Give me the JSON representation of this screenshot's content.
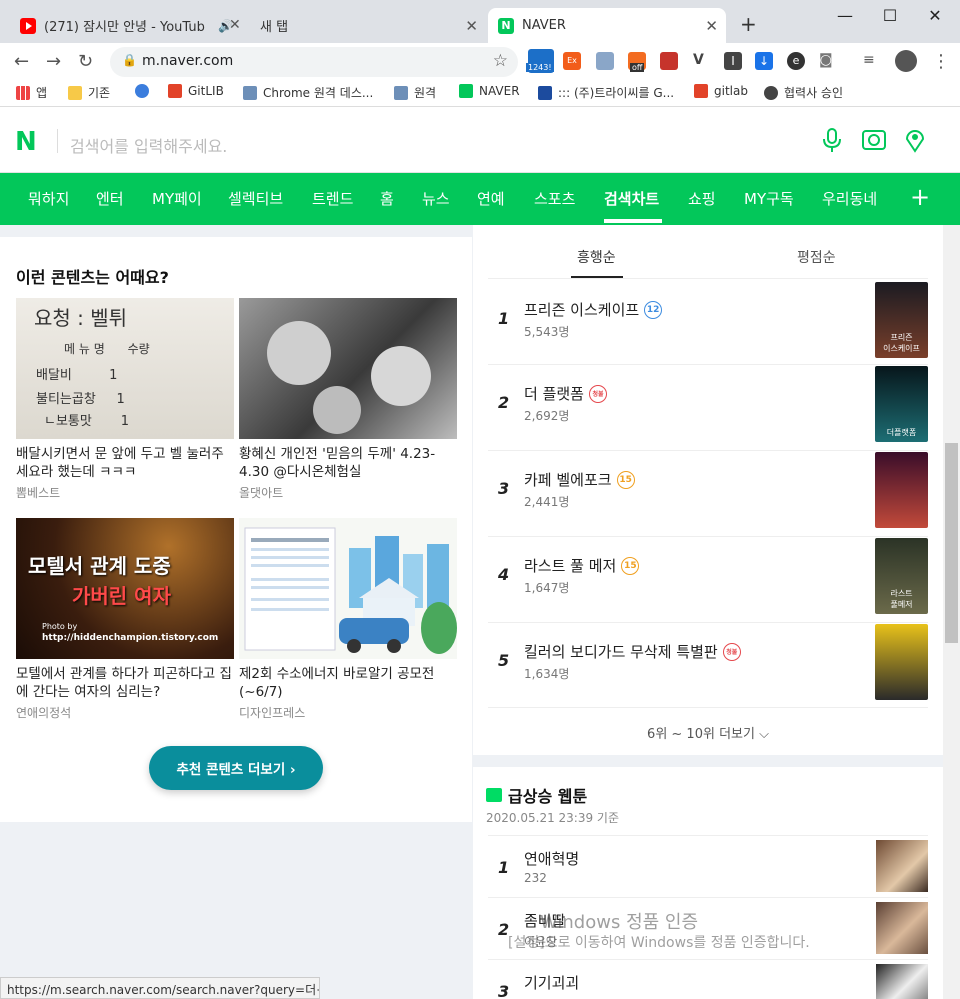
{
  "browser": {
    "tabs": [
      {
        "title": "(271) 잠시만 안녕 - YouTub",
        "audio": "🔊"
      },
      {
        "title": "새 탭"
      },
      {
        "title": "NAVER"
      }
    ],
    "new_tab": "+",
    "window": {
      "minimize": "—",
      "maximize": "☐",
      "close": "✕"
    },
    "url": "m.naver.com",
    "ext_badges": {
      "counter": "1243!",
      "orange": "Ex",
      "off": "off"
    },
    "bookmarks": [
      {
        "label": "앱"
      },
      {
        "label": "기존"
      },
      {
        "label": ""
      },
      {
        "label": "GitLIB"
      },
      {
        "label": "Chrome 원격 데스..."
      },
      {
        "label": "원격"
      },
      {
        "label": "NAVER"
      },
      {
        "label": "::: (주)트라이씨를 G..."
      },
      {
        "label": "gitlab"
      },
      {
        "label": "협력사 승인"
      }
    ]
  },
  "naver": {
    "logo": "N",
    "search_placeholder": "검색어를 입력해주세요.",
    "nav": [
      "뭐하지",
      "엔터",
      "MY페이",
      "셀렉티브",
      "트렌드",
      "홈",
      "뉴스",
      "연예",
      "스포츠",
      "검색차트",
      "쇼핑",
      "MY구독",
      "우리동네"
    ],
    "nav_active": "검색차트",
    "nav_plus": "+"
  },
  "left": {
    "heading": "이런 콘텐츠는 어때요?",
    "cards": [
      {
        "title": "배달시키면서 문 앞에 두고 벨 눌러주세요라 했는데 ㅋㅋㅋ",
        "source": "뽐베스트",
        "thumb_text": [
          "요청 : 벨튀",
          "메 뉴 명      수량",
          "배달비         1",
          "불티는곱창     1",
          "ㄴ보통맛       1"
        ]
      },
      {
        "title": "황혜신 개인전 '믿음의 두께' 4.23-4.30 @다시온체험실",
        "source": "올댓아트"
      },
      {
        "title": "모텔에서 관계를 하다가 피곤하다고 집에 간다는 여자의 심리는?",
        "source": "연애의정석",
        "thumb_text": [
          "모텔서 관계 도중",
          "가버린 여자",
          "Photo by",
          "http://hiddenchampion.tistory.com"
        ]
      },
      {
        "title": "제2회 수소에너지 바로알기 공모전 (~6/7)",
        "source": "디자인프레스"
      }
    ],
    "more_button": "추천 콘텐츠 더보기 ›"
  },
  "movies": {
    "tabs": [
      "흥행순",
      "평점순"
    ],
    "active_tab": "흥행순",
    "items": [
      {
        "rank": "1",
        "title": "프리즌 이스케이프",
        "rating": "12",
        "rating_color": "#3d8ce0",
        "count": "5,543명",
        "poster_colors": [
          "#1b1b22",
          "#7a3f2a"
        ],
        "poster_text": "프리즌\n이스케이프"
      },
      {
        "rank": "2",
        "title": "더 플랫폼",
        "rating": "청불",
        "rating_color": "#e5484d",
        "count": "2,692명",
        "poster_colors": [
          "#07161b",
          "#1d6e74"
        ],
        "poster_text": "더플랫폼"
      },
      {
        "rank": "3",
        "title": "카페 벨에포크",
        "rating": "15",
        "rating_color": "#f0a020",
        "count": "2,441명",
        "poster_colors": [
          "#3a0d2a",
          "#c24a3a"
        ],
        "poster_text": ""
      },
      {
        "rank": "4",
        "title": "라스트 풀 메저",
        "rating": "15",
        "rating_color": "#f0a020",
        "count": "1,647명",
        "poster_colors": [
          "#2b3326",
          "#6b6a4a"
        ],
        "poster_text": "라스트\n풀메저"
      },
      {
        "rank": "5",
        "title": "킬러의 보디가드 무삭제 특별판",
        "rating": "청불",
        "rating_color": "#e5484d",
        "count": "1,634명",
        "poster_colors": [
          "#e8c21a",
          "#2a2a2a"
        ],
        "poster_text": ""
      }
    ],
    "more": "6위 ~ 10위 더보기 ⌵"
  },
  "webtoon": {
    "badge": "NAVER WEBTOON",
    "heading": "급상승 웹툰",
    "date": "2020.05.21 23:39 기준",
    "items": [
      {
        "rank": "1",
        "title": "연애혁명",
        "count": "232"
      },
      {
        "rank": "2",
        "title": "좀비딸",
        "count": "이윤창"
      },
      {
        "rank": "3",
        "title": "기기괴괴",
        "count": ""
      }
    ]
  },
  "overlay": {
    "activate_title": "Windows 정품 인증",
    "activate_sub": "[설정]으로 이동하여 Windows를 정품 인증합니다.",
    "status_url": "https://m.search.naver.com/search.naver?query=더+플..."
  }
}
